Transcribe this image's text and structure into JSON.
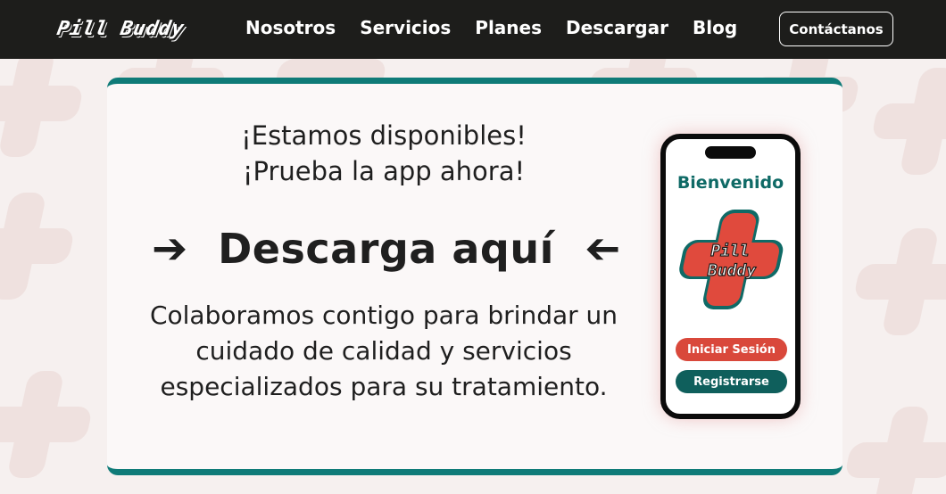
{
  "brand": {
    "logo_text": "Pill Buddy"
  },
  "nav": {
    "links": [
      "Nosotros",
      "Servicios",
      "Planes",
      "Descargar",
      "Blog"
    ],
    "contact_label": "Contáctanos"
  },
  "hero": {
    "headline_line1": "¡Estamos disponibles!",
    "headline_line2": "¡Prueba la app ahora!",
    "download_label": "Descarga aquí",
    "description": "Colaboramos contigo para brindar un cuidado de calidad y servicios especializados para su tratamiento."
  },
  "phone": {
    "welcome": "Bienvenido",
    "logo_text_top": "Pill",
    "logo_text_bottom": "Buddy",
    "login_label": "Iniciar Sesión",
    "register_label": "Registrarse"
  },
  "colors": {
    "navbar": "#1d1d1b",
    "accent_teal": "#0f7b78",
    "accent_red": "#d9483b",
    "background": "#f6f0ef"
  }
}
